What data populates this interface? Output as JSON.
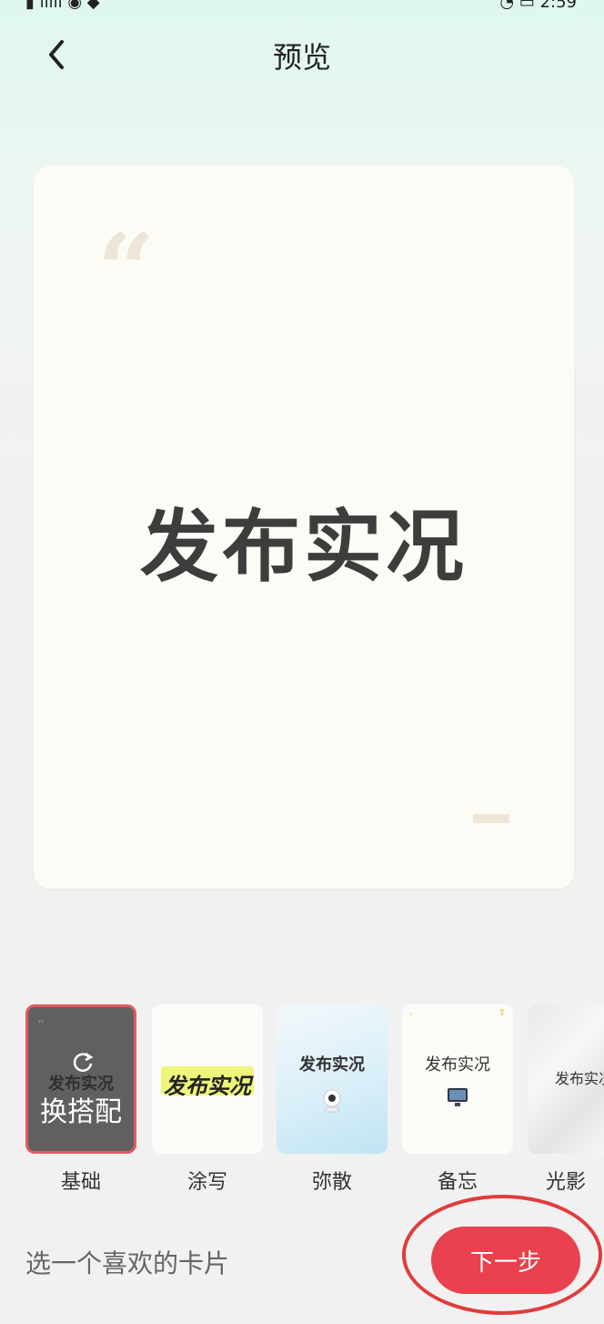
{
  "status_bar": {
    "left": "▮ ıılıı ◉ ◆",
    "right": "◔ ▭ 2:59"
  },
  "header": {
    "title": "预览"
  },
  "card": {
    "headline": "发布实况",
    "quote_mark": "“"
  },
  "selected_overlay": {
    "text_bg": "发布实况",
    "action": "换搭配"
  },
  "thumbnails": [
    {
      "label": "基础"
    },
    {
      "label": "涂写",
      "text": "发布实况"
    },
    {
      "label": "弥散",
      "text": "发布实况"
    },
    {
      "label": "备忘",
      "text": "发布实况"
    },
    {
      "label": "光影",
      "text": "发布实况"
    }
  ],
  "footer": {
    "hint": "选一个喜欢的卡片",
    "next_button": "下一步"
  },
  "colors": {
    "accent": "#e9414d",
    "card_bg": "#fcfbf6",
    "headline": "#3d3d3d"
  }
}
